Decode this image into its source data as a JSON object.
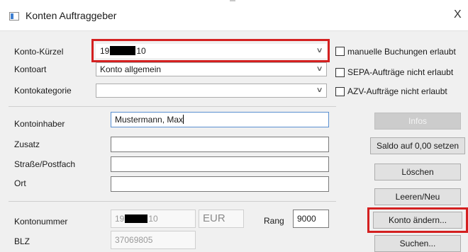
{
  "window": {
    "title": "Konten Auftraggeber",
    "close": "X"
  },
  "fields": {
    "konto_kuerzel": {
      "label": "Konto-Kürzel",
      "prefix": "19",
      "suffix": "10"
    },
    "kontoart": {
      "label": "Kontoart",
      "value": "Konto allgemein"
    },
    "kontokategorie": {
      "label": "Kontokategorie",
      "value": ""
    },
    "kontoinhaber": {
      "label": "Kontoinhaber",
      "value": "Mustermann, Max"
    },
    "zusatz": {
      "label": "Zusatz",
      "value": ""
    },
    "strasse": {
      "label": "Straße/Postfach",
      "value": ""
    },
    "ort": {
      "label": "Ort",
      "value": ""
    },
    "kontonummer": {
      "label": "Kontonummer",
      "prefix": "19",
      "suffix": "10",
      "currency": "EUR"
    },
    "rang": {
      "label": "Rang",
      "value": "9000"
    },
    "blz": {
      "label": "BLZ",
      "value": "37069805"
    }
  },
  "checkboxes": {
    "manuelle": {
      "label": "manuelle Buchungen erlaubt",
      "checked": false
    },
    "sepa": {
      "label": "SEPA-Aufträge nicht erlaubt",
      "checked": false
    },
    "azv": {
      "label": "AZV-Aufträge nicht erlaubt",
      "checked": false
    }
  },
  "buttons": {
    "infos": "Infos",
    "saldo": "Saldo auf 0,00 setzen",
    "loeschen": "Löschen",
    "leeren": "Leeren/Neu",
    "konto_aendern": "Konto ändern...",
    "suchen": "Suchen..."
  },
  "colors": {
    "highlight": "#d42020",
    "focus_border": "#5a8fd0"
  }
}
